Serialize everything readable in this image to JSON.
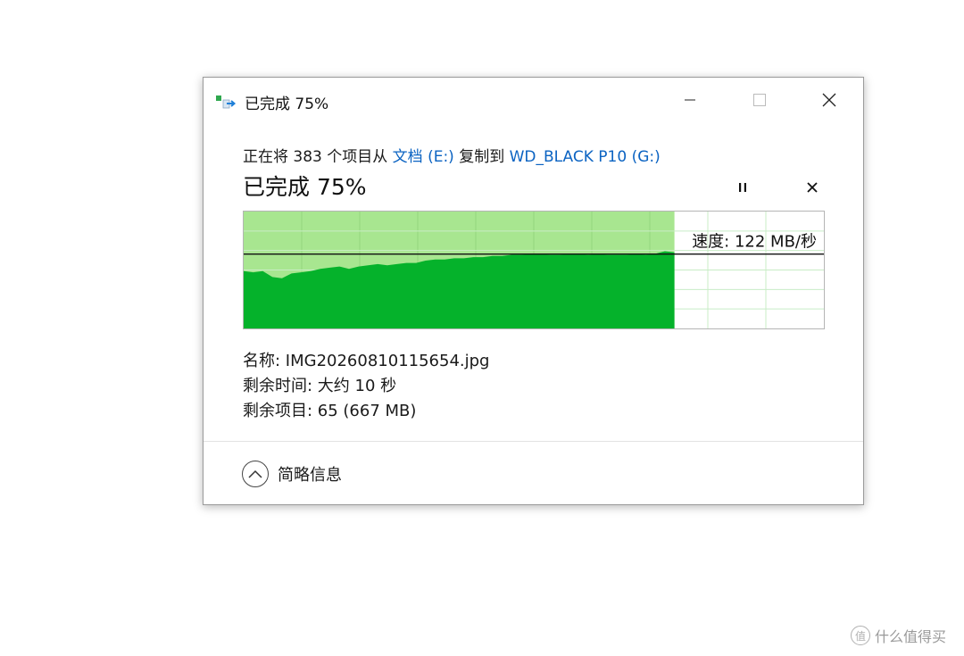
{
  "window": {
    "title": "已完成 75%",
    "icon": "copy-files-icon"
  },
  "copy": {
    "prefix": "正在将 383 个项目从 ",
    "source": "文档 (E:)",
    "middle": " 复制到 ",
    "destination": "WD_BLACK P10 (G:)"
  },
  "progress": {
    "title": "已完成 75%",
    "percent": 75,
    "speed_label": "速度: 122 MB/秒",
    "speed_fraction": 0.636,
    "history": [
      0.49,
      0.48,
      0.49,
      0.44,
      0.43,
      0.47,
      0.48,
      0.49,
      0.51,
      0.52,
      0.53,
      0.51,
      0.53,
      0.54,
      0.55,
      0.54,
      0.55,
      0.56,
      0.56,
      0.58,
      0.59,
      0.59,
      0.6,
      0.6,
      0.61,
      0.61,
      0.62,
      0.62,
      0.63,
      0.63,
      0.64,
      0.64,
      0.63,
      0.63,
      0.64,
      0.64,
      0.63,
      0.64,
      0.63,
      0.63,
      0.63,
      0.64,
      0.63,
      0.64,
      0.66,
      0.65
    ]
  },
  "details": {
    "name": "名称: IMG20260810115654.jpg",
    "time_left": "剩余时间: 大约 10 秒",
    "items_left": "剩余项目: 65 (667 MB)"
  },
  "footer": {
    "less_details": "简略信息"
  },
  "watermark": {
    "text": "什么值得买",
    "badge": "值"
  },
  "colors": {
    "fill": "#05b22b",
    "fill_light": "#a8e690",
    "grid": "#c8ecc6",
    "link": "#0b63c2"
  }
}
